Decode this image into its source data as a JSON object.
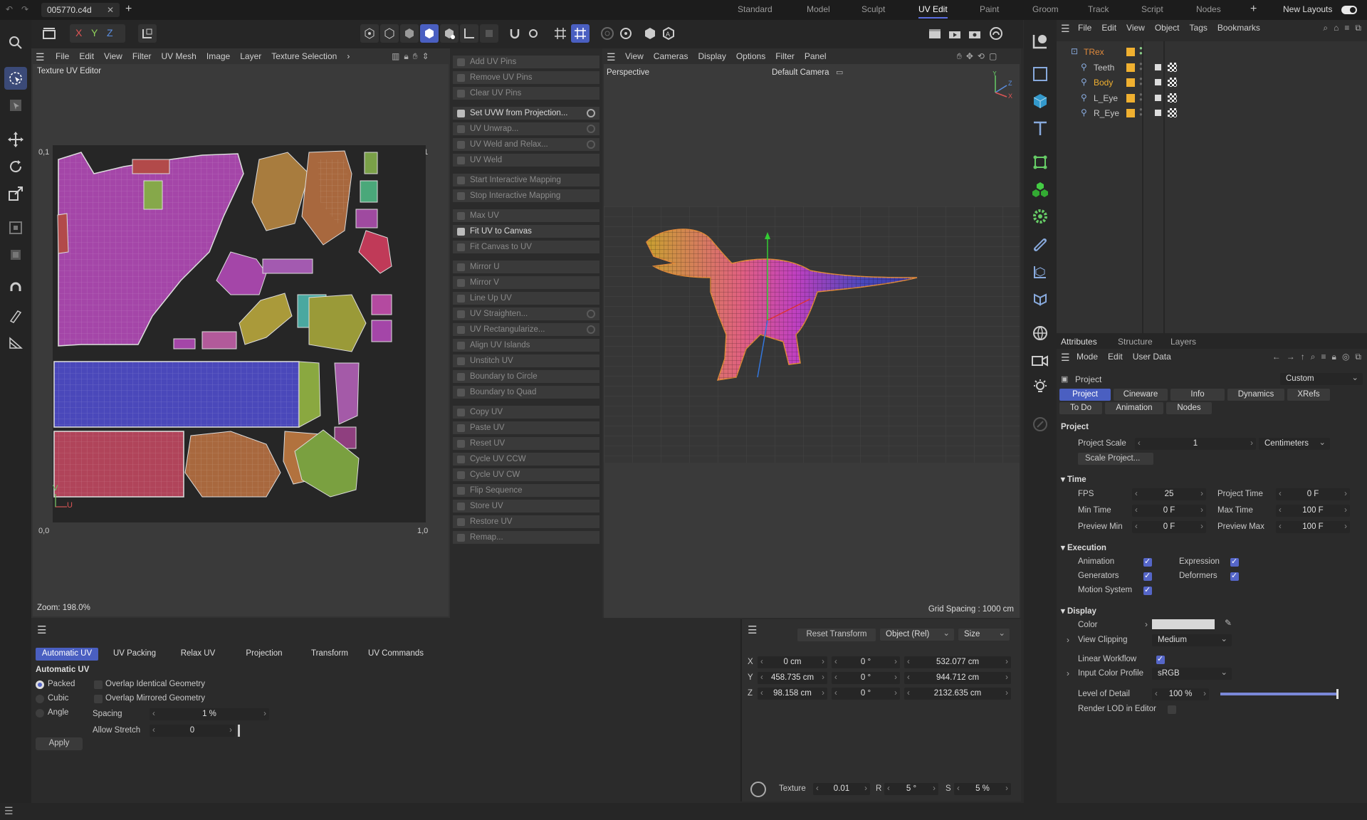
{
  "file_tab": "005770.c4d",
  "layouts": [
    "Standard",
    "Model",
    "Sculpt",
    "UV Edit",
    "Paint",
    "Groom",
    "Track",
    "Script",
    "Nodes"
  ],
  "active_layout": "UV Edit",
  "new_layouts": "New Layouts",
  "axis_buttons": [
    "X",
    "Y",
    "Z"
  ],
  "uv_menu": [
    "File",
    "Edit",
    "View",
    "Filter",
    "UV Mesh",
    "Image",
    "Layer",
    "Texture Selection"
  ],
  "uv_editor": {
    "title": "Texture UV Editor",
    "zoom": "Zoom: 198.0%",
    "coord_tl": "0,1",
    "coord_bl": "0,0",
    "coord_br": "1,0",
    "coord_tr": "1,1",
    "axis_v": "V",
    "axis_u": "U"
  },
  "commands": [
    {
      "label": "Add UV Pins",
      "enabled": false,
      "gear": false
    },
    {
      "label": "Remove UV Pins",
      "enabled": false,
      "gear": false
    },
    {
      "label": "Clear UV Pins",
      "enabled": false,
      "gear": false
    },
    {
      "label": "Set UVW from Projection...",
      "enabled": true,
      "gear": true
    },
    {
      "label": "UV Unwrap...",
      "enabled": false,
      "gear": true
    },
    {
      "label": "UV Weld and Relax...",
      "enabled": false,
      "gear": true
    },
    {
      "label": "UV Weld",
      "enabled": false,
      "gear": false
    },
    {
      "label": "Start Interactive Mapping",
      "enabled": false,
      "gear": false
    },
    {
      "label": "Stop Interactive Mapping",
      "enabled": false,
      "gear": false
    },
    {
      "label": "Max UV",
      "enabled": false,
      "gear": false
    },
    {
      "label": "Fit UV to Canvas",
      "enabled": true,
      "gear": false
    },
    {
      "label": "Fit Canvas to UV",
      "enabled": false,
      "gear": false
    },
    {
      "label": "Mirror U",
      "enabled": false,
      "gear": false
    },
    {
      "label": "Mirror V",
      "enabled": false,
      "gear": false
    },
    {
      "label": "Line Up UV",
      "enabled": false,
      "gear": false
    },
    {
      "label": "UV Straighten...",
      "enabled": false,
      "gear": true
    },
    {
      "label": "UV Rectangularize...",
      "enabled": false,
      "gear": true
    },
    {
      "label": "Align UV Islands",
      "enabled": false,
      "gear": false
    },
    {
      "label": "Unstitch UV",
      "enabled": false,
      "gear": false
    },
    {
      "label": "Boundary to Circle",
      "enabled": false,
      "gear": false
    },
    {
      "label": "Boundary to Quad",
      "enabled": false,
      "gear": false
    },
    {
      "label": "Copy UV",
      "enabled": false,
      "gear": false
    },
    {
      "label": "Paste UV",
      "enabled": false,
      "gear": false
    },
    {
      "label": "Reset UV",
      "enabled": false,
      "gear": false
    },
    {
      "label": "Cycle UV CCW",
      "enabled": false,
      "gear": false
    },
    {
      "label": "Cycle UV CW",
      "enabled": false,
      "gear": false
    },
    {
      "label": "Flip Sequence",
      "enabled": false,
      "gear": false
    },
    {
      "label": "Store UV",
      "enabled": false,
      "gear": false
    },
    {
      "label": "Restore UV",
      "enabled": false,
      "gear": false
    },
    {
      "label": "Remap...",
      "enabled": false,
      "gear": false
    }
  ],
  "viewport": {
    "menu": [
      "View",
      "Cameras",
      "Display",
      "Options",
      "Filter",
      "Panel"
    ],
    "name": "Perspective",
    "camera": "Default Camera",
    "grid": "Grid Spacing : 1000 cm"
  },
  "object_manager": {
    "menu": [
      "File",
      "Edit",
      "View",
      "Object",
      "Tags",
      "Bookmarks"
    ],
    "objects": [
      "TRex",
      "Teeth",
      "Body",
      "L_Eye",
      "R_Eye"
    ]
  },
  "attributes": {
    "tabs": [
      "Attributes",
      "Structure",
      "Layers"
    ],
    "menu": [
      "Mode",
      "Edit",
      "User Data"
    ],
    "context": "Project",
    "preset": "Custom",
    "subtabs_row1": [
      "Project",
      "Cineware",
      "Info",
      "Dynamics",
      "XRefs"
    ],
    "subtabs_row2": [
      "To Do",
      "Animation",
      "Nodes"
    ],
    "section_project": "Project",
    "project_scale_label": "Project Scale",
    "project_scale": "1",
    "project_scale_unit": "Centimeters",
    "scale_project_btn": "Scale Project...",
    "time": {
      "header": "Time",
      "fps_label": "FPS",
      "fps": "25",
      "project_time_label": "Project Time",
      "project_time": "0 F",
      "min_time_label": "Min Time",
      "min_time": "0 F",
      "max_time_label": "Max Time",
      "max_time": "100 F",
      "preview_min_label": "Preview Min",
      "preview_min": "0 F",
      "preview_max_label": "Preview Max",
      "preview_max": "100 F"
    },
    "execution": {
      "header": "Execution",
      "animation": "Animation",
      "expression": "Expression",
      "generators": "Generators",
      "deformers": "Deformers",
      "motion_system": "Motion System"
    },
    "display": {
      "header": "Display",
      "color": "Color",
      "view_clipping": "View Clipping",
      "view_clipping_val": "Medium",
      "linear_workflow": "Linear Workflow",
      "input_color_profile": "Input Color Profile",
      "input_color_profile_val": "sRGB",
      "level_of_detail": "Level of Detail",
      "level_of_detail_val": "100 %",
      "level_of_detail_fraction": 1.0,
      "render_lod": "Render LOD in Editor"
    }
  },
  "bottom_uv": {
    "tabs": [
      "Automatic UV",
      "UV Packing",
      "Relax UV",
      "Projection",
      "Transform",
      "UV Commands"
    ],
    "header": "Automatic UV",
    "radios": [
      "Packed",
      "Cubic",
      "Angle"
    ],
    "overlap_identical": "Overlap Identical Geometry",
    "overlap_mirrored": "Overlap Mirrored Geometry",
    "spacing_label": "Spacing",
    "spacing": "1 %",
    "allow_stretch_label": "Allow Stretch",
    "allow_stretch": "0",
    "apply": "Apply"
  },
  "coords": {
    "reset": "Reset Transform",
    "mode": "Object (Rel)",
    "size": "Size",
    "rows": [
      {
        "axis": "X",
        "pos": "0 cm",
        "rot": "0 °",
        "size": "532.077 cm"
      },
      {
        "axis": "Y",
        "pos": "458.735 cm",
        "rot": "0 °",
        "size": "944.712 cm"
      },
      {
        "axis": "Z",
        "pos": "98.158 cm",
        "rot": "0 °",
        "size": "2132.635 cm"
      }
    ],
    "texture_label": "Texture",
    "texture": "0.01",
    "r_label": "R",
    "r": "5 °",
    "s_label": "S",
    "s": "5 %"
  },
  "colors": {
    "accent": "#4a5fc1",
    "object_yellow": "#f0b030",
    "trex_orange": "#e08a3c"
  }
}
